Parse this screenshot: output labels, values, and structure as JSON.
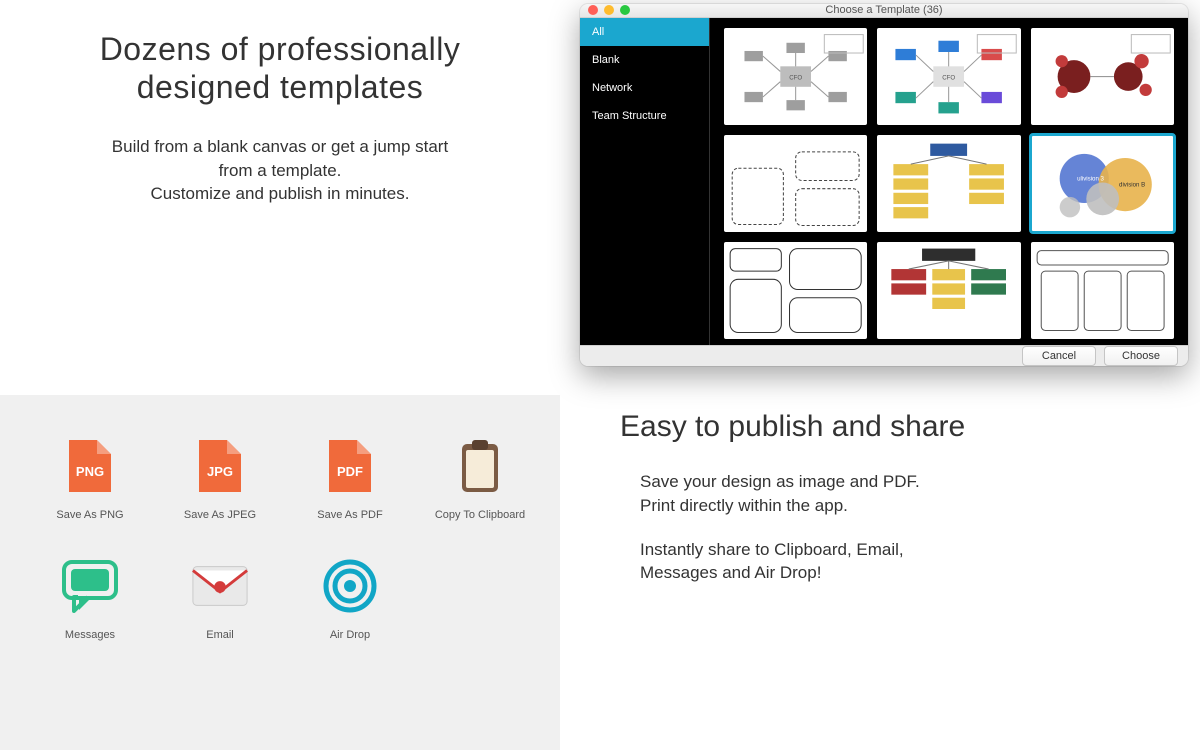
{
  "hero_top": {
    "title_line1": "Dozens of professionally",
    "title_line2": "designed templates",
    "para_line1": "Build from a blank canvas or get a jump start",
    "para_line2": "from a template.",
    "para_line3": "Customize and publish in minutes."
  },
  "template_window": {
    "title": "Choose a Template (36)",
    "sidebar": {
      "items": [
        {
          "label": "All",
          "active": true
        },
        {
          "label": "Blank",
          "active": false
        },
        {
          "label": "Network",
          "active": false
        },
        {
          "label": "Team Structure",
          "active": false
        }
      ]
    },
    "thumb6": {
      "left_label": "ulivision 3",
      "right_label": "division B"
    },
    "selected_index": 5,
    "buttons": {
      "cancel": "Cancel",
      "choose": "Choose"
    }
  },
  "share": {
    "items": [
      {
        "name": "save-png",
        "label": "Save As PNG",
        "badge": "PNG",
        "type": "file",
        "color": "#f06a3b"
      },
      {
        "name": "save-jpeg",
        "label": "Save As JPEG",
        "badge": "JPG",
        "type": "file",
        "color": "#f06a3b"
      },
      {
        "name": "save-pdf",
        "label": "Save As PDF",
        "badge": "PDF",
        "type": "file",
        "color": "#f06a3b"
      },
      {
        "name": "clipboard",
        "label": "Copy To Clipboard",
        "type": "clipboard",
        "color": "#7b5b44"
      },
      {
        "name": "messages",
        "label": "Messages",
        "type": "messages",
        "color": "#2dbf8a"
      },
      {
        "name": "email",
        "label": "Email",
        "type": "email",
        "color": "#e9e9e9"
      },
      {
        "name": "airdrop",
        "label": "Air Drop",
        "type": "airdrop",
        "color": "#11a6c6"
      }
    ]
  },
  "hero_bottom": {
    "title": "Easy to publish and share",
    "p1_line1": "Save your design as image and PDF.",
    "p1_line2": "Print directly within the app.",
    "p2_line1": "Instantly share to Clipboard, Email,",
    "p2_line2": "Messages and Air Drop!"
  }
}
